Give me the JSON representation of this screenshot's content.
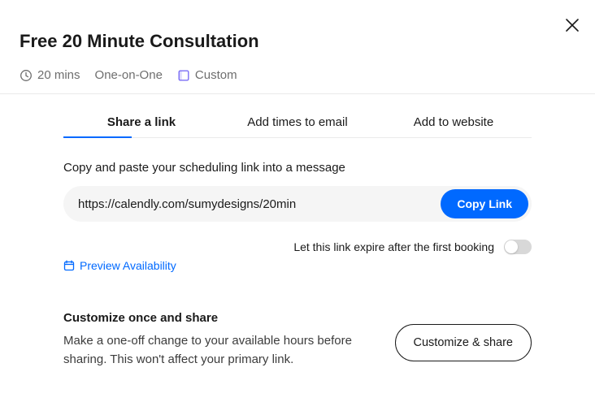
{
  "header": {
    "title": "Free 20 Minute Consultation",
    "duration": "20 mins",
    "type": "One-on-One",
    "custom_label": "Custom"
  },
  "tabs": {
    "share": "Share a link",
    "email": "Add times to email",
    "website": "Add to website"
  },
  "share": {
    "instruction": "Copy and paste your scheduling link into a message",
    "url": "https://calendly.com/sumydesigns/20min",
    "copy_button": "Copy Link",
    "expire_label": "Let this link expire after the first booking",
    "preview_label": "Preview Availability"
  },
  "customize": {
    "title": "Customize once and share",
    "description": "Make a one-off change to your available hours before sharing. This won't affect your primary link.",
    "button": "Customize & share"
  }
}
